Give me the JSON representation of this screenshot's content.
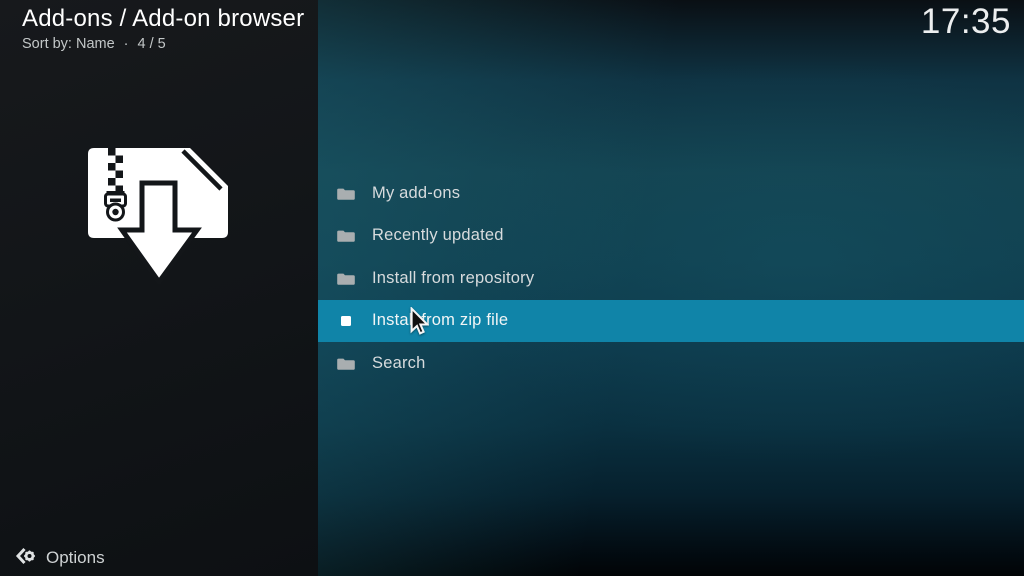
{
  "header": {
    "title": "Add-ons / Add-on browser",
    "sort_label": "Sort by: Name",
    "separator": "·",
    "position_indicator": "4 / 5",
    "clock": "17:35"
  },
  "artwork": {
    "icon": "zip-file-download-icon"
  },
  "menu": {
    "items": [
      {
        "label": "My add-ons",
        "icon": "folder-icon",
        "selected": false
      },
      {
        "label": "Recently updated",
        "icon": "folder-icon",
        "selected": false
      },
      {
        "label": "Install from repository",
        "icon": "folder-icon",
        "selected": false
      },
      {
        "label": "Install from zip file",
        "icon": "file-square-icon",
        "selected": true
      },
      {
        "label": "Search",
        "icon": "folder-icon",
        "selected": false
      }
    ]
  },
  "footer": {
    "options_label": "Options",
    "options_icon": "options-gear-icon"
  },
  "colors": {
    "highlight": "#1084a8",
    "sidebar_background": "#131619",
    "menu_text": "#d7dbdd",
    "selected_text": "#f1f5f6",
    "title_text": "#ffffff",
    "subtitle_text": "#c3c7c8"
  }
}
